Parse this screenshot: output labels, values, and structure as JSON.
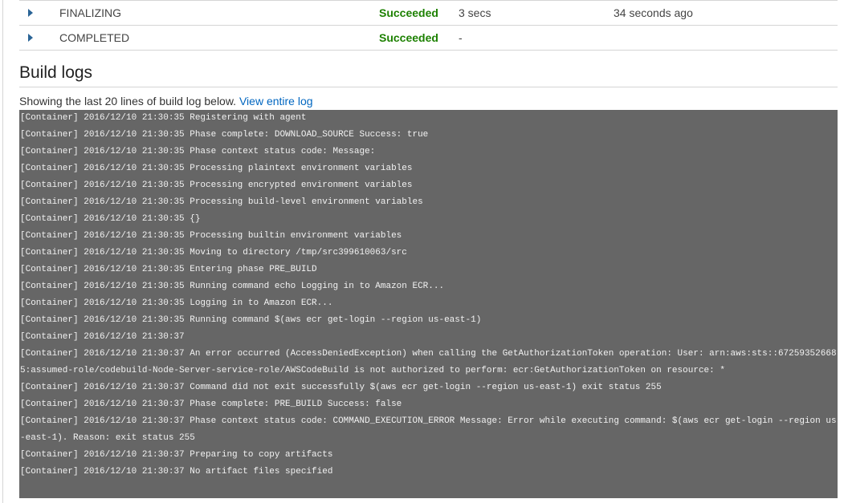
{
  "phases": [
    {
      "name": "FINALIZING",
      "status": "Succeeded",
      "duration": "3 secs",
      "completed": "34 seconds ago"
    },
    {
      "name": "COMPLETED",
      "status": "Succeeded",
      "duration": "-",
      "completed": ""
    }
  ],
  "build_logs": {
    "title": "Build logs",
    "caption": "Showing the last 20 lines of build log below.",
    "view_link": "View entire log",
    "lines": [
      "[Container] 2016/12/10 21:30:35 Registering with agent",
      "[Container] 2016/12/10 21:30:35 Phase complete: DOWNLOAD_SOURCE Success: true",
      "[Container] 2016/12/10 21:30:35 Phase context status code: Message:",
      "[Container] 2016/12/10 21:30:35 Processing plaintext environment variables",
      "[Container] 2016/12/10 21:30:35 Processing encrypted environment variables",
      "[Container] 2016/12/10 21:30:35 Processing build-level environment variables",
      "[Container] 2016/12/10 21:30:35 {}",
      "[Container] 2016/12/10 21:30:35 Processing builtin environment variables",
      "[Container] 2016/12/10 21:30:35 Moving to directory /tmp/src399610063/src",
      "[Container] 2016/12/10 21:30:35 Entering phase PRE_BUILD",
      "[Container] 2016/12/10 21:30:35 Running command echo Logging in to Amazon ECR...",
      "[Container] 2016/12/10 21:30:35 Logging in to Amazon ECR...",
      "[Container] 2016/12/10 21:30:35 Running command $(aws ecr get-login --region us-east-1)",
      "[Container] 2016/12/10 21:30:37",
      "[Container] 2016/12/10 21:30:37 An error occurred (AccessDeniedException) when calling the GetAuthorizationToken operation: User: arn:aws:sts::672593526685:assumed-role/codebuild-Node-Server-service-role/AWSCodeBuild is not authorized to perform: ecr:GetAuthorizationToken on resource: *",
      "[Container] 2016/12/10 21:30:37 Command did not exit successfully $(aws ecr get-login --region us-east-1) exit status 255",
      "[Container] 2016/12/10 21:30:37 Phase complete: PRE_BUILD Success: false",
      "[Container] 2016/12/10 21:30:37 Phase context status code: COMMAND_EXECUTION_ERROR Message: Error while executing command: $(aws ecr get-login --region us-east-1). Reason: exit status 255",
      "[Container] 2016/12/10 21:30:37 Preparing to copy artifacts",
      "[Container] 2016/12/10 21:30:37 No artifact files specified"
    ]
  },
  "colors": {
    "success": "#1d8102",
    "link": "#0066c0",
    "log_background": "#666666",
    "expand_arrow": "#2a6496"
  }
}
